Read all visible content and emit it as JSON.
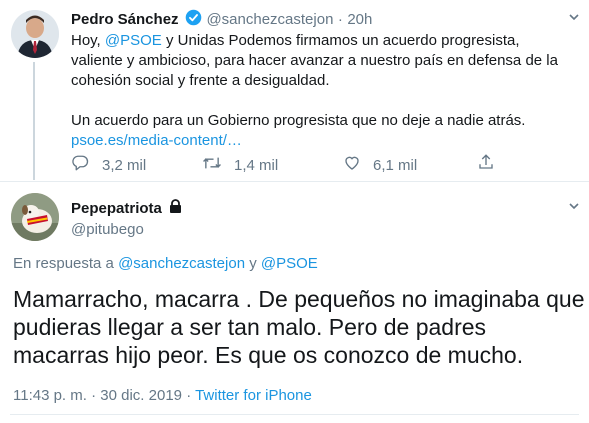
{
  "tweet1": {
    "author_name": "Pedro Sánchez",
    "handle": "@sanchezcastejon",
    "sep": "·",
    "time": "20h",
    "body": {
      "p1": "Hoy,",
      "mention": "@PSOE",
      "p1_rest_line1": " y Unidas Podemos firmamos un acuerdo progresista,",
      "line2": "valiente y ambicioso, para hacer avanzar a nuestro país en defensa de la",
      "line3": "cohesión social y frente a desigualdad.",
      "line5": "Un acuerdo para un Gobierno progresista que no deje a nadie atrás.",
      "link": "psoe.es/media-content/…"
    },
    "stats": {
      "replies": "3,2 mil",
      "retweets": "1,4 mil",
      "likes": "6,1 mil"
    }
  },
  "tweet2": {
    "author_name": "Pepepatriota",
    "handle": "@pitubego",
    "reply_prefix": "En respuesta a",
    "reply_to_1": "@sanchezcastejon",
    "reply_and": "y",
    "reply_to_2": "@PSOE",
    "body_line1": "Mamarracho, macarra . De pequeños no imaginaba que",
    "body_line2": "pudieras llegar a ser tan malo.  Pero de padres",
    "body_line3": "macarras hijo peor. Es que os conozco de mucho.",
    "time": "11:43 p. m.",
    "dot": "·",
    "date": "30 dic. 2019",
    "dot2": "·",
    "source": "Twitter for iPhone"
  },
  "colors": {
    "link": "#1b95e0",
    "muted": "#657786",
    "verified": "#1da1f2"
  }
}
